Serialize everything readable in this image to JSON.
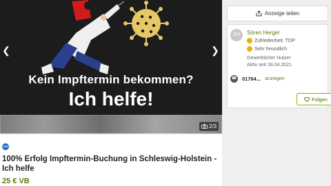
{
  "gallery": {
    "headline_line1": "Kein Impftermin bekommen?",
    "headline_line2": "Ich helfe!",
    "counter": "2/3",
    "prev_icon": "chevron-left-icon",
    "next_icon": "chevron-right-icon",
    "camera_icon": "camera-icon"
  },
  "listing": {
    "top_badge": "TOP",
    "title": "100% Erfolg Impftermin-Buchung in Schleswig-Holstein - Ich helfe",
    "price": "25 € VB"
  },
  "sidebar": {
    "share_label": "Anzeige teilen",
    "seller": {
      "initials": "SH",
      "name": "Sören Hergel",
      "badge1": "Zufriedenheit: TOP",
      "badge2": "Sehr freundlich",
      "type": "Gewerblicher Nutzer",
      "since": "Aktiv seit 28.04.2021",
      "phone": "01764...",
      "phone_show": "anzeigen",
      "follow_label": "Folgen"
    }
  },
  "colors": {
    "accent": "#5f7c00",
    "gallery_bg": "#1c1c1c"
  }
}
